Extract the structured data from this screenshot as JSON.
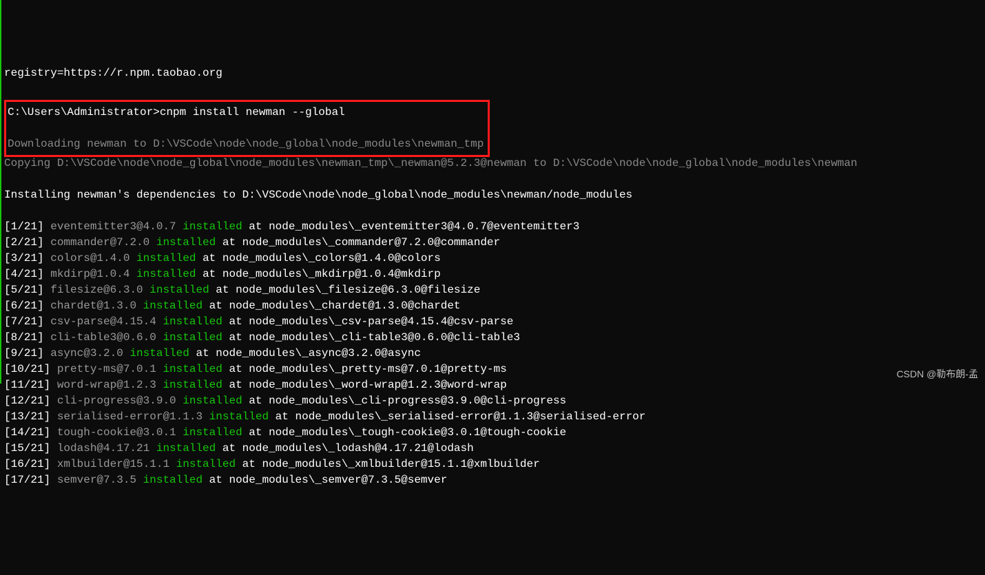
{
  "header_line": "registry=https://r.npm.taobao.org",
  "prompt": "C:\\Users\\Administrator>",
  "command": "cnpm install newman --global",
  "downloading": "Downloading newman to D:\\VSCode\\node\\node_global\\node_modules\\newman_tmp",
  "copying": "Copying D:\\VSCode\\node\\node_global\\node_modules\\newman_tmp\\_newman@5.2.3@newman to D:\\VSCode\\node\\node_global\\node_modules\\newman",
  "installing": "Installing newman's dependencies to D:\\VSCode\\node\\node_global\\node_modules\\newman/node_modules",
  "rows": [
    {
      "counter": "[1/21] ",
      "pkg": "eventemitter3@4.0.7 ",
      "status": "installed",
      "rest": " at node_modules\\_eventemitter3@4.0.7@eventemitter3"
    },
    {
      "counter": "[2/21] ",
      "pkg": "commander@7.2.0 ",
      "status": "installed",
      "rest": " at node_modules\\_commander@7.2.0@commander"
    },
    {
      "counter": "[3/21] ",
      "pkg": "colors@1.4.0 ",
      "status": "installed",
      "rest": " at node_modules\\_colors@1.4.0@colors"
    },
    {
      "counter": "[4/21] ",
      "pkg": "mkdirp@1.0.4 ",
      "status": "installed",
      "rest": " at node_modules\\_mkdirp@1.0.4@mkdirp"
    },
    {
      "counter": "[5/21] ",
      "pkg": "filesize@6.3.0 ",
      "status": "installed",
      "rest": " at node_modules\\_filesize@6.3.0@filesize"
    },
    {
      "counter": "[6/21] ",
      "pkg": "chardet@1.3.0 ",
      "status": "installed",
      "rest": " at node_modules\\_chardet@1.3.0@chardet"
    },
    {
      "counter": "[7/21] ",
      "pkg": "csv-parse@4.15.4 ",
      "status": "installed",
      "rest": " at node_modules\\_csv-parse@4.15.4@csv-parse"
    },
    {
      "counter": "[8/21] ",
      "pkg": "cli-table3@0.6.0 ",
      "status": "installed",
      "rest": " at node_modules\\_cli-table3@0.6.0@cli-table3"
    },
    {
      "counter": "[9/21] ",
      "pkg": "async@3.2.0 ",
      "status": "installed",
      "rest": " at node_modules\\_async@3.2.0@async"
    },
    {
      "counter": "[10/21] ",
      "pkg": "pretty-ms@7.0.1 ",
      "status": "installed",
      "rest": " at node_modules\\_pretty-ms@7.0.1@pretty-ms"
    },
    {
      "counter": "[11/21] ",
      "pkg": "word-wrap@1.2.3 ",
      "status": "installed",
      "rest": " at node_modules\\_word-wrap@1.2.3@word-wrap"
    },
    {
      "counter": "[12/21] ",
      "pkg": "cli-progress@3.9.0 ",
      "status": "installed",
      "rest": " at node_modules\\_cli-progress@3.9.0@cli-progress"
    },
    {
      "counter": "[13/21] ",
      "pkg": "serialised-error@1.1.3 ",
      "status": "installed",
      "rest": " at node_modules\\_serialised-error@1.1.3@serialised-error"
    },
    {
      "counter": "[14/21] ",
      "pkg": "tough-cookie@3.0.1 ",
      "status": "installed",
      "rest": " at node_modules\\_tough-cookie@3.0.1@tough-cookie"
    },
    {
      "counter": "[15/21] ",
      "pkg": "lodash@4.17.21 ",
      "status": "installed",
      "rest": " at node_modules\\_lodash@4.17.21@lodash"
    },
    {
      "counter": "[16/21] ",
      "pkg": "xmlbuilder@15.1.1 ",
      "status": "installed",
      "rest": " at node_modules\\_xmlbuilder@15.1.1@xmlbuilder"
    },
    {
      "counter": "[17/21] ",
      "pkg": "semver@7.3.5 ",
      "status": "installed",
      "rest": " at node_modules\\_semver@7.3.5@semver"
    }
  ],
  "watermark": "CSDN @勒布朗-孟"
}
